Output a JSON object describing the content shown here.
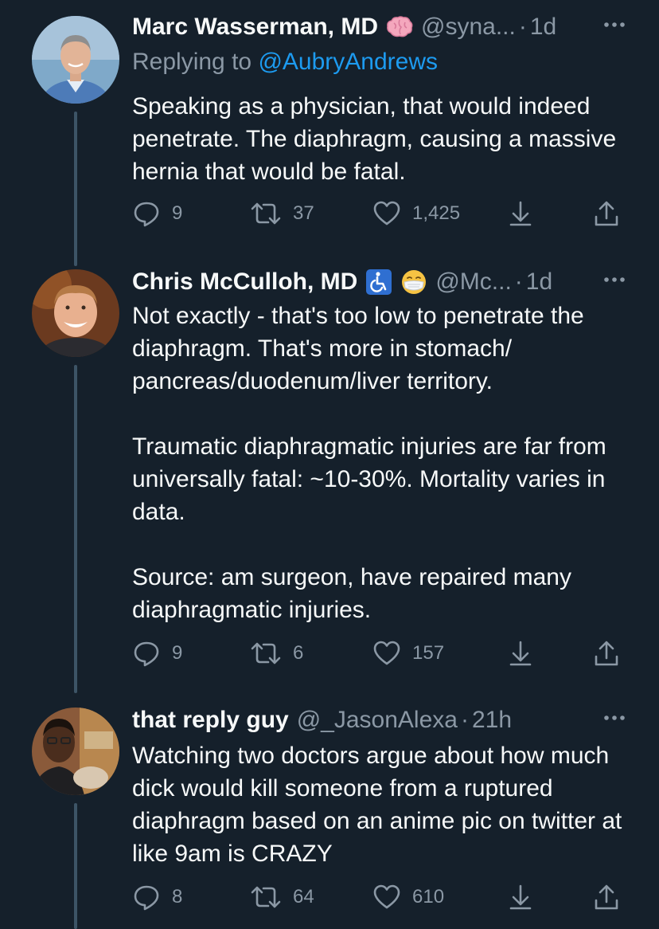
{
  "tweets": [
    {
      "name": "Marc Wasserman, MD",
      "badge_emoji": "brain",
      "handle": "@syna...",
      "time": "1d",
      "replying_prefix": "Replying to ",
      "replying_to": "@AubryAndrews",
      "paragraphs": [
        "Speaking as a physician, that would indeed penetrate.  The diaphragm, causing a massive hernia that would be fatal."
      ],
      "replies": "9",
      "retweets": "37",
      "likes": "1,425"
    },
    {
      "name": "Chris McCulloh, MD",
      "badge_emoji": "wheelchair-symbol, face-with-medical-mask",
      "handle": "@Mc...",
      "time": "1d",
      "paragraphs": [
        "Not exactly - that's too low to penetrate the diaphragm. That's more in stomach/ pancreas/duodenum/liver territory.",
        "Traumatic diaphragmatic injuries are far from universally fatal: ~10-30%. Mortality varies in data.",
        "Source: am surgeon, have repaired many diaphragmatic injuries."
      ],
      "replies": "9",
      "retweets": "6",
      "likes": "157"
    },
    {
      "name": "that reply guy",
      "handle": "@_JasonAlexa",
      "time": "21h",
      "paragraphs": [
        "Watching two doctors argue about how much dick would kill someone from a ruptured diaphragm based on an anime pic on twitter at like 9am is CRAZY"
      ],
      "replies": "8",
      "retweets": "64",
      "likes": "610"
    }
  ],
  "colors": {
    "background": "#15202b",
    "primary_text": "#f7f9f9",
    "secondary_text": "#8b98a5",
    "link": "#1d9bf0",
    "thread_line": "#3d5466"
  },
  "icons": [
    "reply-icon",
    "retweet-icon",
    "like-icon",
    "bookmark-icon",
    "share-icon",
    "more-icon"
  ]
}
